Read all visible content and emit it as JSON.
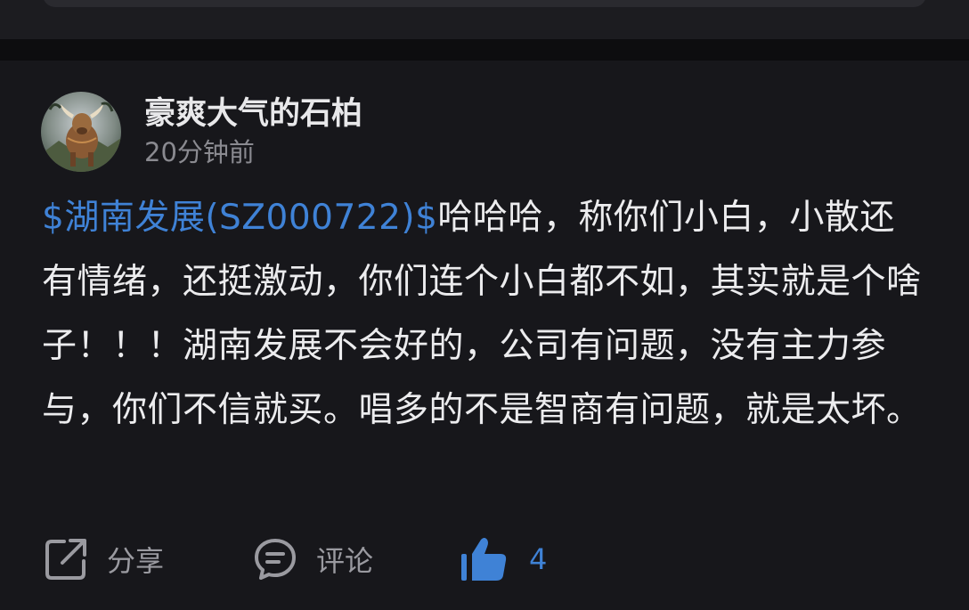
{
  "post": {
    "author": {
      "name": "豪爽大气的石柏",
      "avatar_icon": "bull-avatar-icon"
    },
    "time": "20分钟前",
    "stock_tag": "$湖南发展(SZ000722)$",
    "body_text": "哈哈哈，称你们小白，小散还有情绪，还挺激动，你们连个小白都不如，其实就是个啥子！！！湖南发展不会好的，公司有问题，没有主力参与，你们不信就买。唱多的不是智商有问题，就是太坏。"
  },
  "actions": {
    "share_label": "分享",
    "comment_label": "评论",
    "like_count": "4"
  },
  "colors": {
    "background": "#17171b",
    "stock_tag": "#3f82d6",
    "like_active": "#3f82d6"
  }
}
